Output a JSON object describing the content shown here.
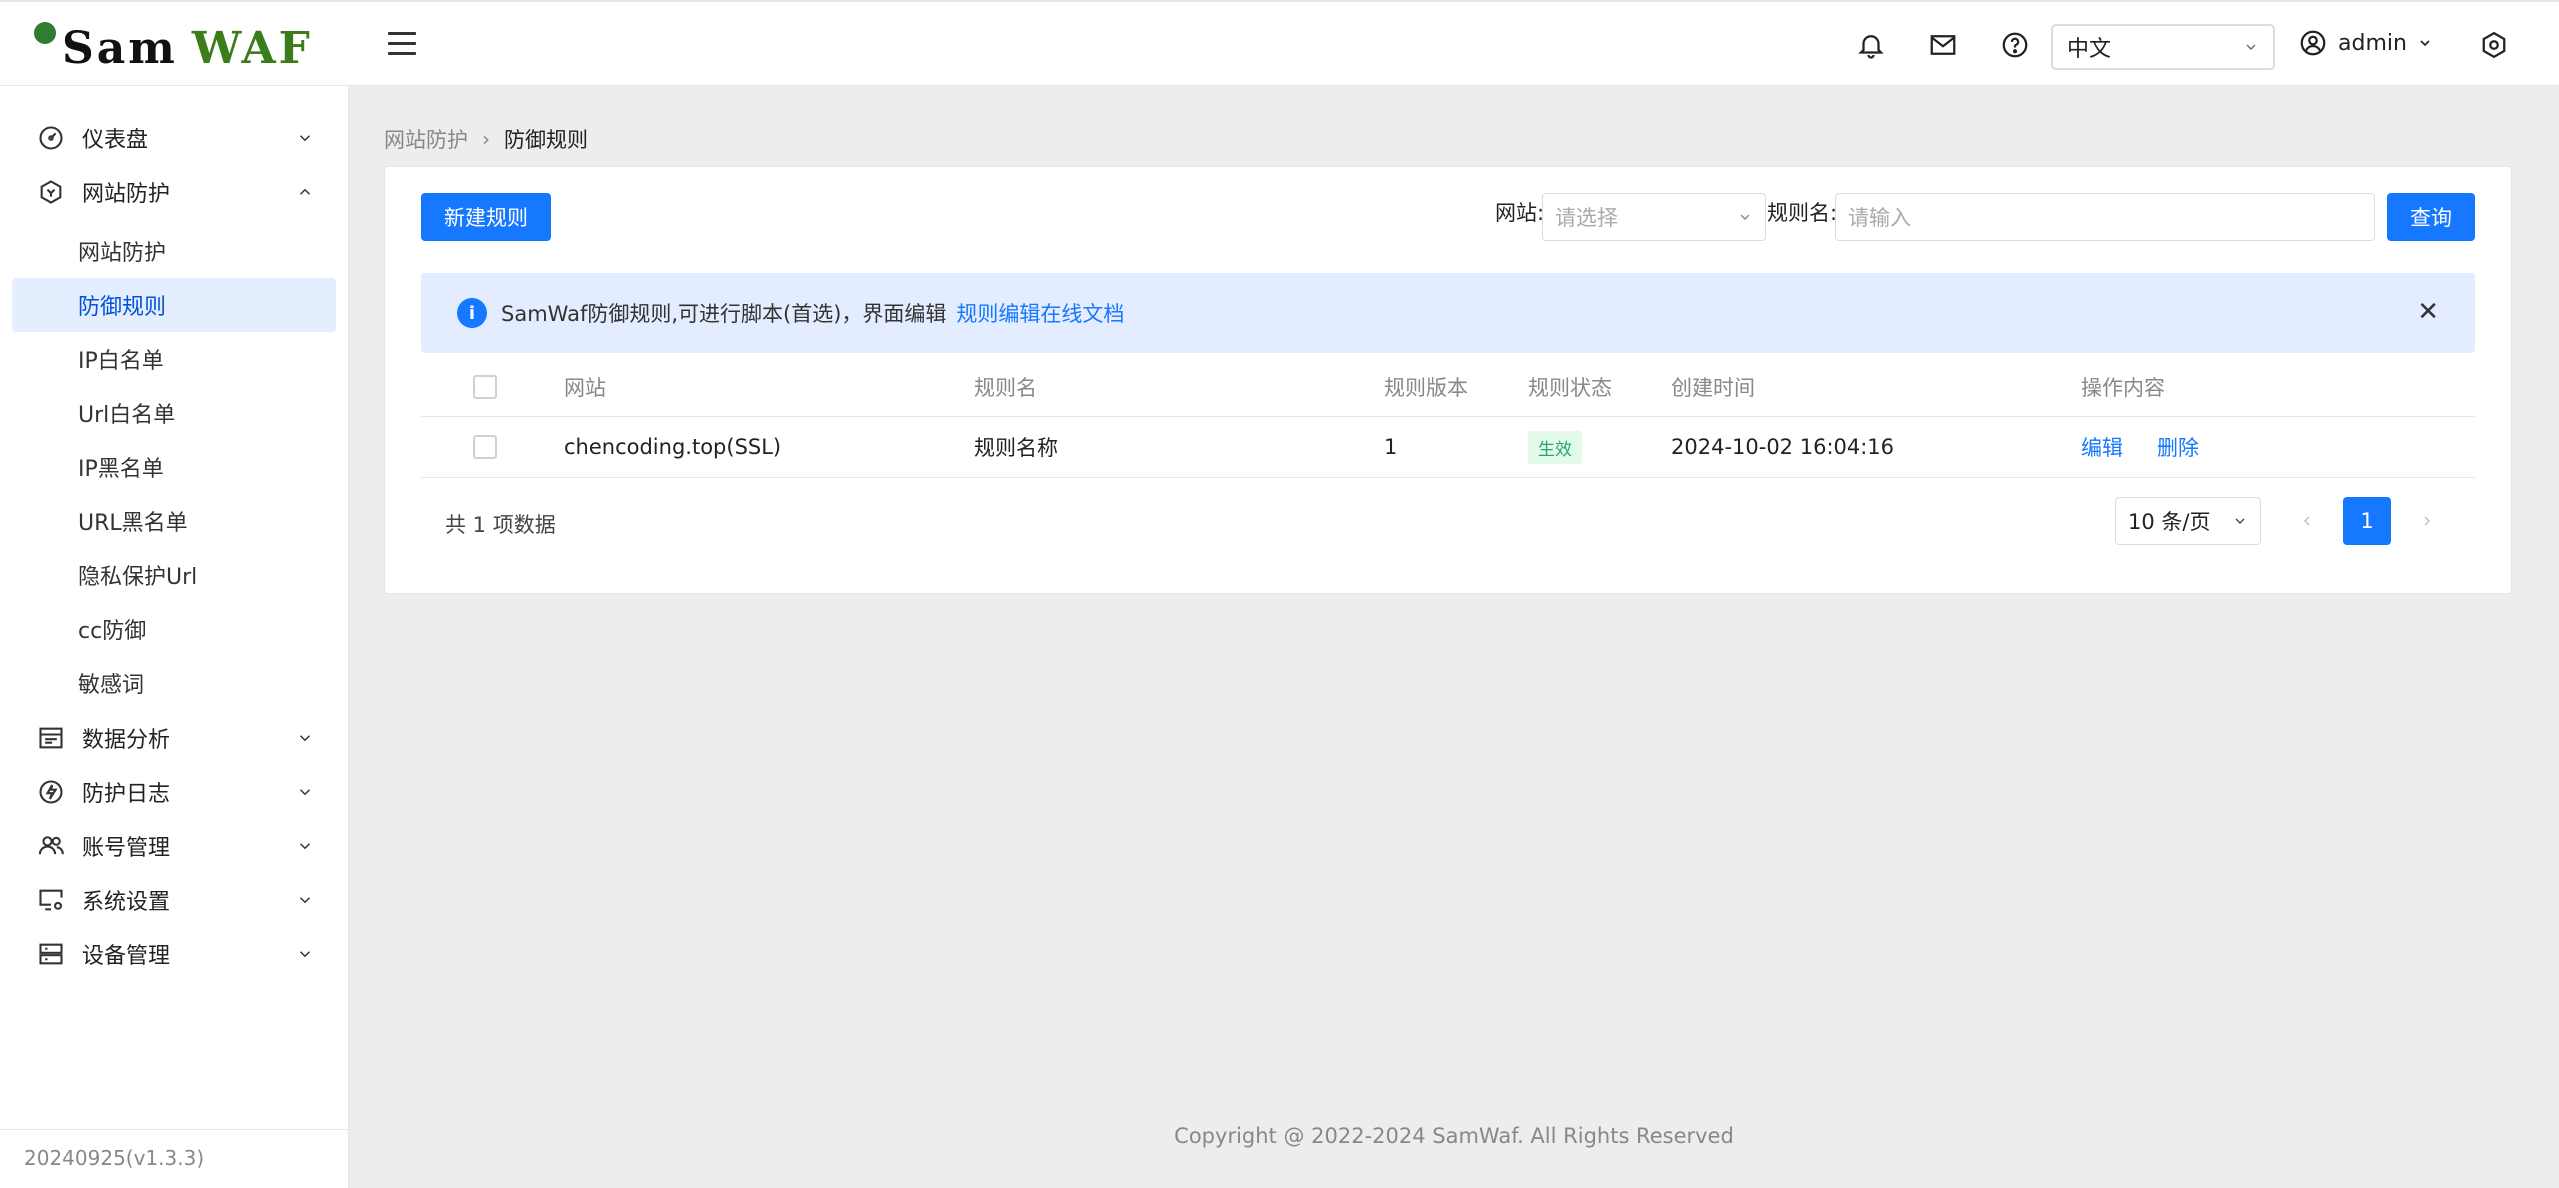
{
  "app": {
    "logo_sam": "Sam",
    "logo_waf": "WAF"
  },
  "header": {
    "language": "中文",
    "user": "admin"
  },
  "sidebar": {
    "groups": {
      "dashboard": "仪表盘",
      "site_protection": "网站防护",
      "data_analysis": "数据分析",
      "protection_log": "防护日志",
      "account": "账号管理",
      "system_settings": "系统设置",
      "device": "设备管理"
    },
    "sub_items": [
      "网站防护",
      "防御规则",
      "IP白名单",
      "Url白名单",
      "IP黑名单",
      "URL黑名单",
      "隐私保护Url",
      "cc防御",
      "敏感词"
    ],
    "version": "20240925(v1.3.3)"
  },
  "breadcrumb": {
    "parent": "网站防护",
    "current": "防御规则"
  },
  "toolbar": {
    "new_rule": "新建规则",
    "site_label": "网站:",
    "site_placeholder": "请选择",
    "rule_name_label": "规则名:",
    "rule_name_placeholder": "请输入",
    "query": "查询"
  },
  "alert": {
    "message": "SamWaf防御规则,可进行脚本(首选)，界面编辑",
    "link": "规则编辑在线文档"
  },
  "table": {
    "headers": [
      "网站",
      "规则名",
      "规则版本",
      "规则状态",
      "创建时间",
      "操作内容"
    ],
    "rows": [
      {
        "site": "chencoding.top(SSL)",
        "rule_name": "规则名称",
        "version": "1",
        "status": "生效",
        "created": "2024-10-02 16:04:16",
        "edit": "编辑",
        "delete": "删除"
      }
    ]
  },
  "pagination": {
    "total": "共 1 项数据",
    "page_size": "10 条/页",
    "current_page": "1"
  },
  "footer": "Copyright @ 2022-2024 SamWaf. All Rights Reserved",
  "colors": {
    "primary": "#1677ff",
    "active_bg": "#e5eeff",
    "success": "#2ba471",
    "brand_green": "#3a7d1a"
  }
}
